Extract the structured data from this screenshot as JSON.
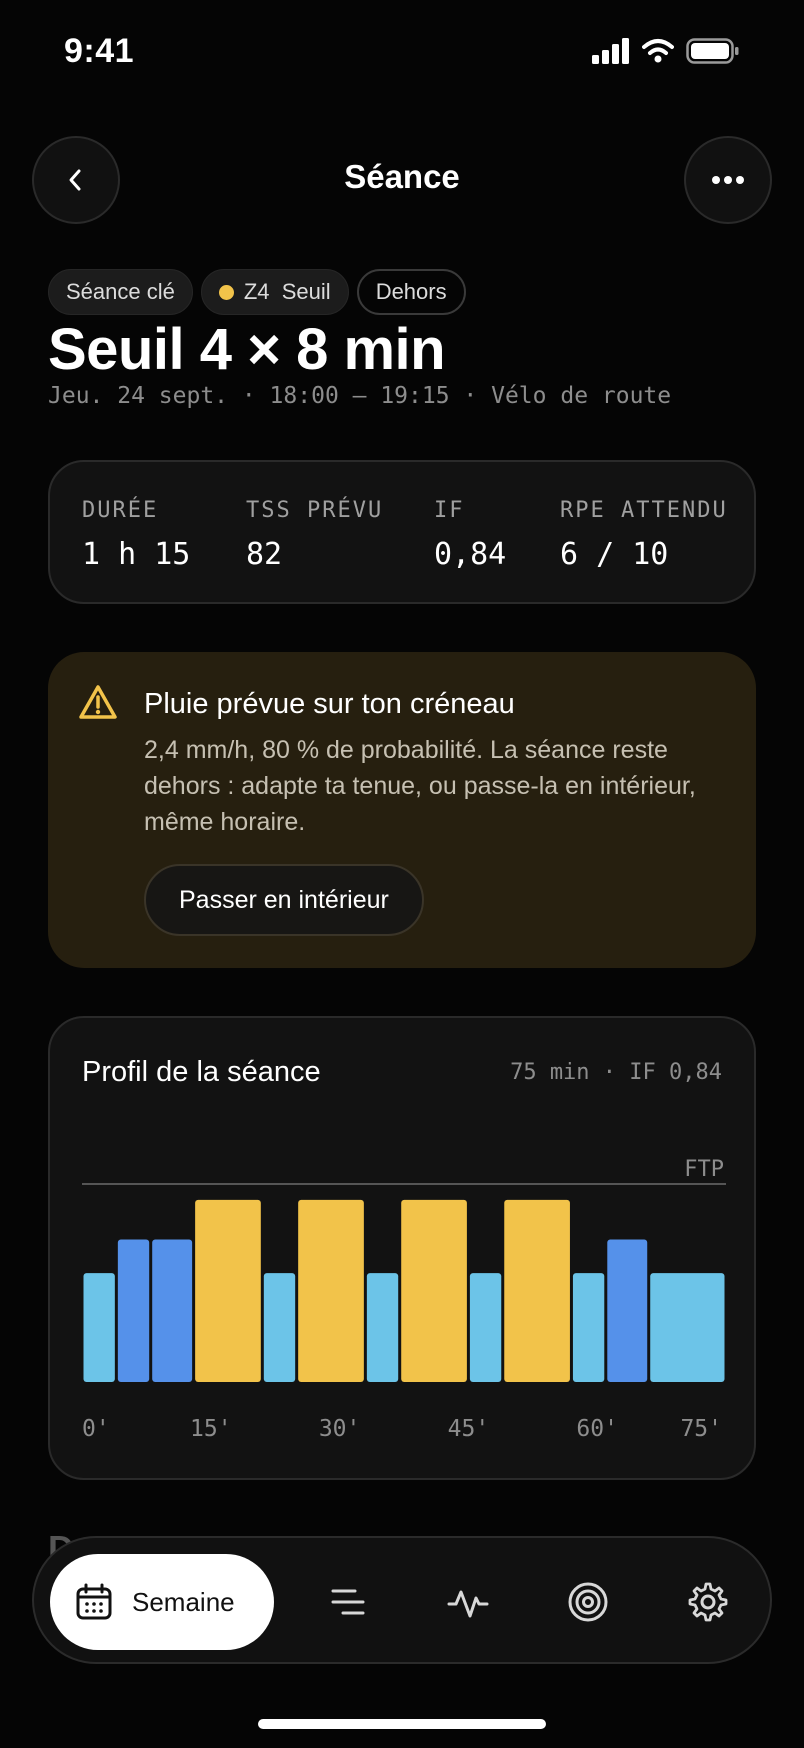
{
  "status": {
    "time": "9:41"
  },
  "header": {
    "title": "Séance"
  },
  "tags": [
    {
      "label": "Séance clé"
    },
    {
      "label": "Z4  Seuil",
      "dot_color": "#f2c34a"
    },
    {
      "label": "Dehors"
    }
  ],
  "workout": {
    "title": "Seuil 4 × 8 min",
    "subtitle": "Jeu. 24 sept. · 18:00 – 19:15 · Vélo de route"
  },
  "metrics": [
    {
      "label": "DURÉE",
      "value": "1 h 15"
    },
    {
      "label": "TSS PRÉVU",
      "value": "82"
    },
    {
      "label": "IF",
      "value": "0,84"
    },
    {
      "label": "RPE ATTENDU",
      "value": "6 / 10"
    }
  ],
  "alert": {
    "title": "Pluie prévue sur ton créneau",
    "text": "2,4 mm/h, 80 % de probabilité. La séance reste dehors : adapte ta tenue, ou passe-la en intérieur, même horaire.",
    "button": "Passer en intérieur",
    "icon": "warning-icon",
    "accent": "#f2c34a"
  },
  "profile": {
    "title": "Profil de la séance",
    "meta": "75 min · IF 0,84"
  },
  "chart_data": {
    "type": "bar",
    "title": "Profil de la séance",
    "xlabel": "",
    "ylabel": "",
    "x_ticks": [
      "0'",
      "15'",
      "30'",
      "45'",
      "60'",
      "75'"
    ],
    "xlim": [
      0,
      75
    ],
    "ylim": [
      0,
      1.3
    ],
    "reference_line": {
      "label": "FTP",
      "value": 1.0
    },
    "segments": [
      {
        "start": 0,
        "end": 4,
        "value": 0.55,
        "color": "#6cc4e8"
      },
      {
        "start": 4,
        "end": 8,
        "value": 0.72,
        "color": "#5591ea"
      },
      {
        "start": 8,
        "end": 13,
        "value": 0.72,
        "color": "#5591ea"
      },
      {
        "start": 13,
        "end": 21,
        "value": 0.92,
        "color": "#f2c34a"
      },
      {
        "start": 21,
        "end": 25,
        "value": 0.55,
        "color": "#6cc4e8"
      },
      {
        "start": 25,
        "end": 33,
        "value": 0.92,
        "color": "#f2c34a"
      },
      {
        "start": 33,
        "end": 37,
        "value": 0.55,
        "color": "#6cc4e8"
      },
      {
        "start": 37,
        "end": 45,
        "value": 0.92,
        "color": "#f2c34a"
      },
      {
        "start": 45,
        "end": 49,
        "value": 0.55,
        "color": "#6cc4e8"
      },
      {
        "start": 49,
        "end": 57,
        "value": 0.92,
        "color": "#f2c34a"
      },
      {
        "start": 57,
        "end": 61,
        "value": 0.55,
        "color": "#6cc4e8"
      },
      {
        "start": 61,
        "end": 66,
        "value": 0.72,
        "color": "#5591ea"
      },
      {
        "start": 66,
        "end": 75,
        "value": 0.55,
        "color": "#6cc4e8"
      }
    ],
    "grid": false
  },
  "peek": {
    "label": "D"
  },
  "nav": {
    "active_label": "Semaine",
    "items": [
      "calendar-icon",
      "list-icon",
      "activity-icon",
      "target-icon",
      "gear-icon"
    ]
  }
}
